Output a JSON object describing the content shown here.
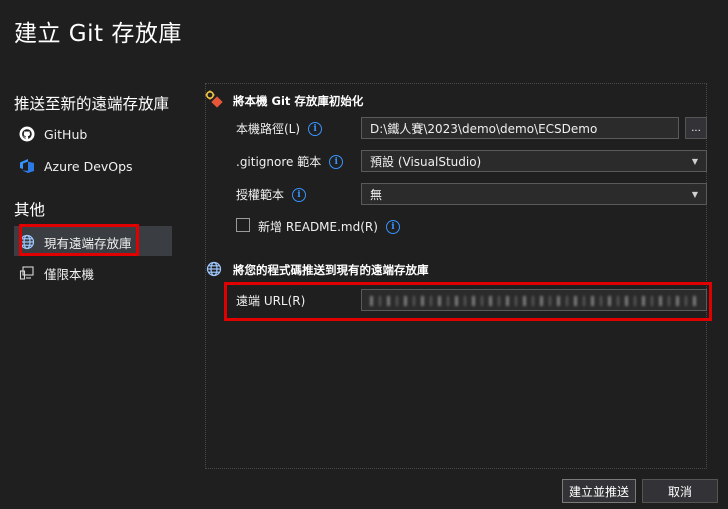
{
  "window": {
    "title": "建立 Git 存放庫"
  },
  "sidebar": {
    "push_header": "推送至新的遠端存放庫",
    "github": "GitHub",
    "azure": "Azure DevOps",
    "other_header": "其他",
    "existing_remote": "現有遠端存放庫",
    "local_only": "僅限本機"
  },
  "init_section": {
    "title": "將本機 Git 存放庫初始化",
    "path_label": "本機路徑(L)",
    "path_value": "D:\\鐵人賽\\2023\\demo\\demo\\ECSDemo",
    "browse_label": "...",
    "gitignore_label": ".gitignore 範本",
    "gitignore_value": "預設 (VisualStudio)",
    "license_label": "授權範本",
    "license_value": "無",
    "readme_label": "新增 README.md(R)"
  },
  "push_section": {
    "title": "將您的程式碼推送到現有的遠端存放庫",
    "remote_label": "遠端 URL(R)"
  },
  "footer": {
    "create_push": "建立並推送",
    "cancel": "取消"
  },
  "colors": {
    "accent": "#3794ff",
    "highlight": "#e00000",
    "background": "#1f1f1f"
  }
}
